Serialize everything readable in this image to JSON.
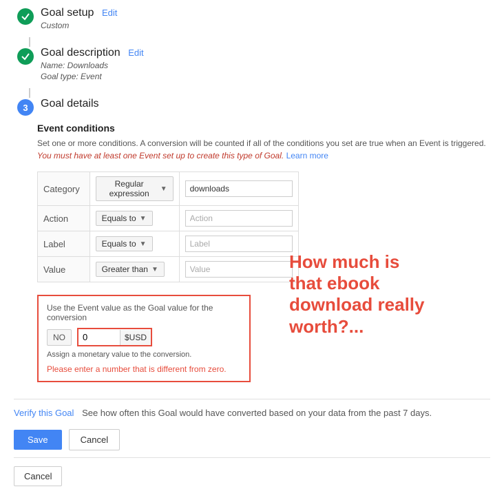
{
  "steps": {
    "step1": {
      "title": "Goal setup",
      "edit_label": "Edit",
      "sub": "Custom"
    },
    "step2": {
      "title": "Goal description",
      "edit_label": "Edit",
      "sub_name": "Name: Downloads",
      "sub_type": "Goal type: Event"
    },
    "step3": {
      "number": "3",
      "title": "Goal details"
    }
  },
  "goal_details": {
    "section_title": "Event conditions",
    "description_part1": "Set one or more conditions. A conversion will be counted if all of the conditions you set are true when an Event is triggered. ",
    "description_italic": "You must have at least one Event set up to create this type of Goal.",
    "learn_more": "Learn more"
  },
  "conditions": {
    "rows": [
      {
        "label": "Category",
        "dropdown": "Regular expression",
        "value": "downloads",
        "placeholder": ""
      },
      {
        "label": "Action",
        "dropdown": "Equals to",
        "value": "",
        "placeholder": "Action"
      },
      {
        "label": "Label",
        "dropdown": "Equals to",
        "value": "",
        "placeholder": "Label"
      },
      {
        "label": "Value",
        "dropdown": "Greater than",
        "value": "",
        "placeholder": "Value"
      }
    ]
  },
  "event_value": {
    "label": "Use the Event value as the Goal value for the conversion",
    "no_button": "NO",
    "input_value": "0",
    "currency": "$USD",
    "assign_text": "Assign a monetary value to the conversion.",
    "error_text": "Please enter a number that is different from zero."
  },
  "annotation": {
    "line1": "How much is",
    "line2": "that ebook",
    "line3": "download really",
    "line4": "worth?..."
  },
  "verify": {
    "link_label": "Verify this Goal",
    "description": "See how often this Goal would have converted based on your data from the past 7 days."
  },
  "action_buttons": {
    "save": "Save",
    "cancel": "Cancel"
  },
  "bottom": {
    "cancel": "Cancel"
  }
}
